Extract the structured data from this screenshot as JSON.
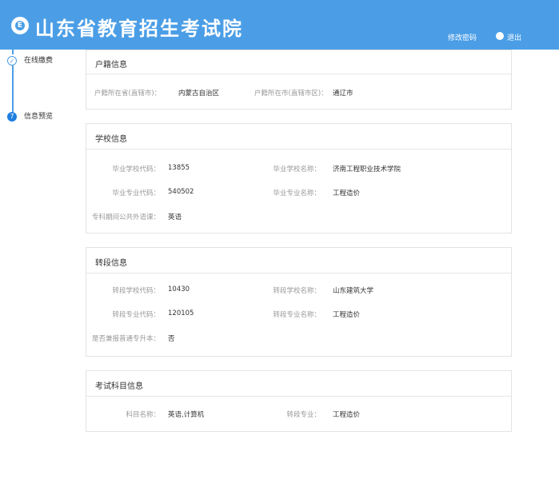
{
  "header": {
    "title": "山东省教育招生考试院",
    "logo_letter": "E",
    "change_password": "修改密码",
    "logout": "退出"
  },
  "steps": [
    {
      "label": "在线缴费",
      "state": "done",
      "marker": "✓"
    },
    {
      "label": "信息预览",
      "state": "active",
      "marker": "7"
    }
  ],
  "household": {
    "title": "户籍信息",
    "province_label": "户籍所在省(直辖市)：",
    "province_value": "内蒙古自治区",
    "city_label": "户籍所在市(直辖市区)：",
    "city_value": "通辽市"
  },
  "school": {
    "title": "学校信息",
    "school_code_label": "毕业学校代码：",
    "school_code_value": "13855",
    "school_name_label": "毕业学校名称：",
    "school_name_value": "济南工程职业技术学院",
    "major_code_label": "毕业专业代码：",
    "major_code_value": "540502",
    "major_name_label": "毕业专业名称：",
    "major_name_value": "工程造价",
    "language_label": "专科期间公共外语课：",
    "language_value": "英语"
  },
  "transfer": {
    "title": "转段信息",
    "school_code_label": "转段学校代码：",
    "school_code_value": "10430",
    "school_name_label": "转段学校名称：",
    "school_name_value": "山东建筑大学",
    "major_code_label": "转段专业代码：",
    "major_code_value": "120105",
    "major_name_label": "转段专业名称：",
    "major_name_value": "工程造价",
    "also_apply_label": "是否兼报普通专升本：",
    "also_apply_value": "否"
  },
  "exam": {
    "title": "考试科目信息",
    "subjects_label": "科目名称：",
    "subjects_value": "英语,计算机",
    "transfer_major_label": "转段专业：",
    "transfer_major_value": "工程造价"
  }
}
